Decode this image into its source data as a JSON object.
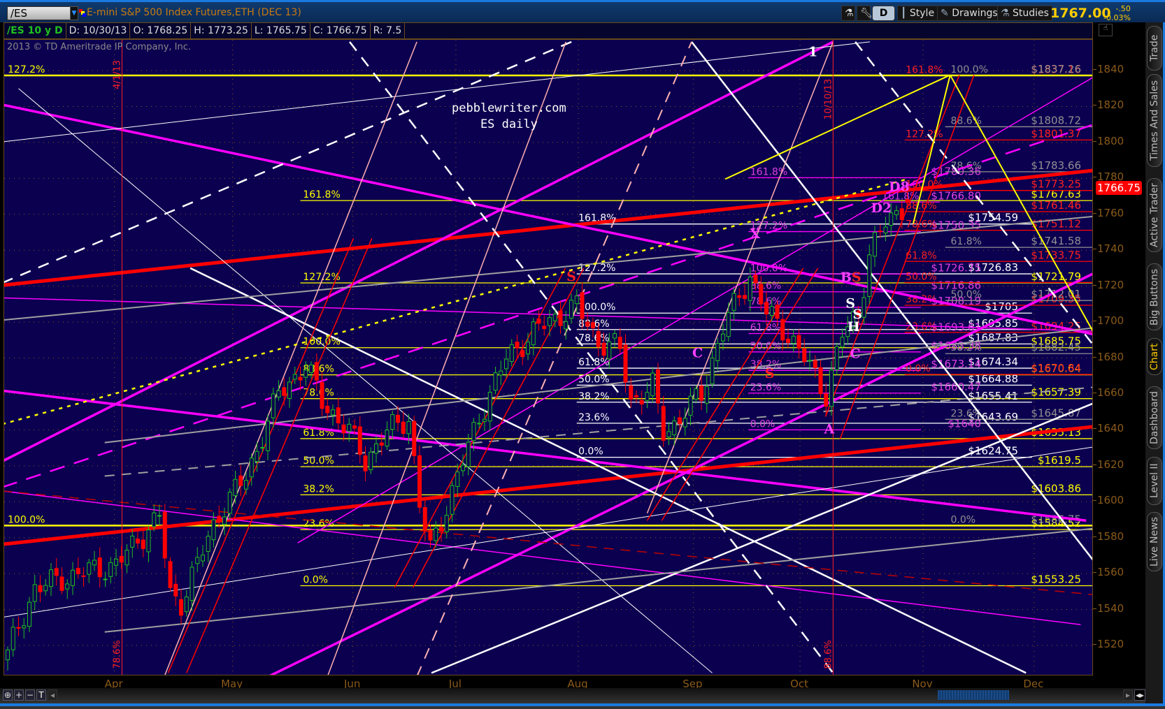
{
  "header": {
    "symbol": "/ES",
    "description": "E-mini S&P 500 Index Futures,ETH (DEC 13)",
    "buttons": {
      "d": "D",
      "style": "Style",
      "drawings": "Drawings",
      "studies": "Studies"
    },
    "last_price": "1767.00",
    "change": "-.50",
    "change_pct": "-0.03%"
  },
  "infobar": {
    "symbol_period": "/ES 10 y D",
    "date": "D: 10/30/13",
    "open": "O: 1768.25",
    "high": "H: 1773.25",
    "low": "L: 1765.75",
    "close": "C: 1766.75",
    "range": "R: 7.5"
  },
  "copyright": "2013 © TD Ameritrade IP Company, Inc.",
  "current_price_badge": "1766.75",
  "side_tabs": [
    "Trade",
    "Times And Sales",
    "Active Trader",
    "Big Buttons",
    "Chart",
    "Dashboard",
    "Level II",
    "Live News"
  ],
  "active_tab": "Chart",
  "colors": {
    "plot_bg": "#0b0050",
    "up": "#1fc01f",
    "down": "#ff0000",
    "axis": "#8a5a1a",
    "accent": "#ffcc00"
  },
  "chart_data": {
    "type": "candlestick",
    "title": "pebblewriter.com",
    "subtitle": "ES daily",
    "bars": 167,
    "last_bar": {
      "date": "10/30/13",
      "open": 1768.25,
      "high": 1773.25,
      "low": 1765.75,
      "close": 1766.75
    },
    "close_waypoints": [
      [
        0,
        1515
      ],
      [
        5,
        1552
      ],
      [
        13,
        1560
      ],
      [
        20,
        1565
      ],
      [
        28,
        1592
      ],
      [
        30,
        1548
      ],
      [
        32,
        1544
      ],
      [
        39,
        1594
      ],
      [
        44,
        1614
      ],
      [
        50,
        1660
      ],
      [
        55,
        1676
      ],
      [
        58,
        1656
      ],
      [
        63,
        1639
      ],
      [
        66,
        1623
      ],
      [
        70,
        1639
      ],
      [
        74,
        1647
      ],
      [
        76,
        1598
      ],
      [
        78,
        1573
      ],
      [
        81,
        1598
      ],
      [
        87,
        1647
      ],
      [
        92,
        1680
      ],
      [
        98,
        1697
      ],
      [
        105,
        1709
      ],
      [
        109,
        1689
      ],
      [
        113,
        1685
      ],
      [
        115,
        1656
      ],
      [
        119,
        1664
      ],
      [
        121,
        1639
      ],
      [
        123,
        1643
      ],
      [
        128,
        1660
      ],
      [
        132,
        1697
      ],
      [
        137,
        1726
      ],
      [
        140,
        1705
      ],
      [
        143,
        1697
      ],
      [
        147,
        1680
      ],
      [
        151,
        1660
      ],
      [
        154,
        1693
      ],
      [
        157,
        1705
      ],
      [
        159,
        1738
      ],
      [
        162,
        1755
      ],
      [
        166,
        1766.75
      ]
    ],
    "ylim": [
      1505,
      1855
    ],
    "y_ticks": [
      1520,
      1540,
      1560,
      1580,
      1600,
      1620,
      1640,
      1660,
      1680,
      1700,
      1720,
      1740,
      1760,
      1780,
      1800,
      1820,
      1840
    ],
    "x_ticks": [
      {
        "label": "Apr",
        "bar": 19.7
      },
      {
        "label": "May",
        "bar": 41.5
      },
      {
        "label": "Jun",
        "bar": 63.7
      },
      {
        "label": "Jul",
        "bar": 82.7
      },
      {
        "label": "Aug",
        "bar": 105.3
      },
      {
        "label": "Sep",
        "bar": 126.5
      },
      {
        "label": "Oct",
        "bar": 146.2
      },
      {
        "label": "Nov",
        "bar": 168.9
      },
      {
        "label": "Dec",
        "bar": 189.4
      }
    ],
    "fibs": {
      "yellow": [
        {
          "label": "0.0%",
          "price": 1553.25,
          "price_label": "$1553.25"
        },
        {
          "label": "23.6%",
          "price": 1584.52,
          "price_label": "$1584.52"
        },
        {
          "label": "38.2%",
          "price": 1603.86,
          "price_label": "$1603.86"
        },
        {
          "label": "50.0%",
          "price": 1619.5,
          "price_label": "$1619.5"
        },
        {
          "label": "61.8%",
          "price": 1635.13,
          "price_label": "$1635.13"
        },
        {
          "label": "78.6%",
          "price": 1657.39,
          "price_label": "$1657.39"
        },
        {
          "label": "88.6%",
          "price": 1670.64,
          "price_label": "$1670.64"
        },
        {
          "label": "100.0%",
          "price": 1685.75,
          "price_label": "$1685.75"
        },
        {
          "label": "127.2%",
          "price": 1721.79,
          "price_label": "$1721.79"
        },
        {
          "label": "161.8%",
          "price": 1767.63,
          "price_label": "$1767.63"
        }
      ],
      "white": [
        {
          "label": "0.0%",
          "price": 1624.75,
          "price_label": "$1624.75"
        },
        {
          "label": "23.6%",
          "price": 1643.69,
          "price_label": "$1643.69"
        },
        {
          "label": "38.2%",
          "price": 1655.41,
          "price_label": "$1655.41"
        },
        {
          "label": "50.0%",
          "price": 1664.88,
          "price_label": "$1664.88"
        },
        {
          "label": "61.8%",
          "price": 1674.34,
          "price_label": "$1674.34"
        },
        {
          "label": "78.6%",
          "price": 1687.83,
          "price_label": "$1687.83"
        },
        {
          "label": "88.6%",
          "price": 1695.85,
          "price_label": "$1695.85"
        },
        {
          "label": "100.0%",
          "price": 1705,
          "price_label": "$1705"
        },
        {
          "label": "127.2%",
          "price": 1726.83,
          "price_label": "$1726.83"
        },
        {
          "label": "161.8%",
          "price": 1754.59,
          "price_label": "$1754.59"
        }
      ],
      "magenta": [
        {
          "label": "0.0%",
          "price": 1640,
          "price_label": "$1640"
        },
        {
          "label": "23.6%",
          "price": 1660.47,
          "price_label": "$1660.47"
        },
        {
          "label": "38.2%",
          "price": 1673.14,
          "price_label": "$1673.14"
        },
        {
          "label": "50.0%",
          "price": 1683.38,
          "price_label": "$1683.38"
        },
        {
          "label": "61.8%",
          "price": 1693.61,
          "price_label": "$1693.61"
        },
        {
          "label": "78.6%",
          "price": 1708.19,
          "price_label": "$1708.19"
        },
        {
          "label": "88.6%",
          "price": 1716.86,
          "price_label": "$1716.86"
        },
        {
          "label": "100.0%",
          "price": 1726.75,
          "price_label": "$1726.75"
        },
        {
          "label": "127.2%",
          "price": 1750.35,
          "price_label": "$1750.35"
        },
        {
          "label": "161.8%",
          "price": 1780.36,
          "price_label": "$1780.36"
        }
      ],
      "magenta2": [
        {
          "label": "161.8%",
          "price": 1766.8,
          "price_label": "$1766.80"
        }
      ],
      "red": [
        {
          "label": "0.0%",
          "price": 1670.84,
          "price_label": "$1670.84"
        },
        {
          "label": "23.6%",
          "price": 1694.25,
          "price_label": "$1694.25"
        },
        {
          "label": "38.2%",
          "price": 1709.35,
          "price_label": "$1709.35"
        },
        {
          "label": "50.0%",
          "price": 1722.05,
          "price_label": null
        },
        {
          "label": "61.8%",
          "price": 1733.75,
          "price_label": "$1733.75"
        },
        {
          "label": "78.6%",
          "price": 1751.12,
          "price_label": "$1751.12"
        },
        {
          "label": "88.6%",
          "price": 1761.46,
          "price_label": "$1761.46"
        },
        {
          "label": "100.0%",
          "price": 1773.25,
          "price_label": "$1773.25"
        },
        {
          "label": "127.2%",
          "price": 1801.37,
          "price_label": "$1801.37"
        },
        {
          "label": "161.8%",
          "price": 1837.16,
          "price_label": "$1837.16"
        }
      ],
      "gray": [
        {
          "label": "0.0%",
          "price": 1586.75,
          "price_label": "$1586.75"
        },
        {
          "label": "23.6%",
          "price": 1645.87,
          "price_label": "$1645.87"
        },
        {
          "label": "38.2%",
          "price": 1682.45,
          "price_label": "$1682.45"
        },
        {
          "label": "50.0%",
          "price": 1712.01,
          "price_label": "$1712.01"
        },
        {
          "label": "61.8%",
          "price": 1741.58,
          "price_label": "$1741.58"
        },
        {
          "label": "78.6%",
          "price": 1783.66,
          "price_label": "$1783.66"
        },
        {
          "label": "88.6%",
          "price": 1808.72,
          "price_label": "$1808.72"
        },
        {
          "label": "100.0%",
          "price": 1837.26,
          "price_label": "$1837.26"
        }
      ],
      "yellow_left": [
        {
          "label": "100.0%",
          "price": 1586.75,
          "price_label": null
        },
        {
          "label": "127.2%",
          "price": 1837.26,
          "price_label": null
        }
      ]
    },
    "vertical_lines": [
      {
        "bar": 21.1,
        "top_label": "4/1/13",
        "bottom_label": "78.6%"
      },
      {
        "bar": 152.3,
        "top_label": "10/10/13",
        "bottom_label": "88.6%"
      }
    ],
    "trendlines": [
      {
        "from": [
          -1,
          1720.5
        ],
        "to": [
          201,
          1784.6
        ],
        "style": "red-thick"
      },
      {
        "from": [
          -1,
          1576.3
        ],
        "to": [
          201,
          1642.0
        ],
        "style": "red-thick"
      },
      {
        "from": [
          -1,
          1622.5
        ],
        "to": [
          152.3,
          1856
        ],
        "style": "magenta-thick"
      },
      {
        "from": [
          48.1,
          1502.7
        ],
        "to": [
          201,
          1728
        ],
        "style": "magenta-thick"
      },
      {
        "from": [
          -1,
          1821
        ],
        "to": [
          201,
          1692.8
        ],
        "style": "magenta-thick"
      },
      {
        "from": [
          -1,
          1661.8
        ],
        "to": [
          199,
          1589.5
        ],
        "style": "magenta-thick"
      },
      {
        "from": [
          -1,
          1713.5
        ],
        "to": [
          201,
          1694.9
        ],
        "style": "magenta"
      },
      {
        "from": [
          -1,
          1608.1
        ],
        "to": [
          201,
          1810.6
        ],
        "style": "magenta-dash"
      },
      {
        "from": [
          -1,
          1606
        ],
        "to": [
          198,
          1531.6
        ],
        "style": "magenta"
      },
      {
        "from": [
          53.5,
          1577.1
        ],
        "to": [
          201,
          1837.5
        ],
        "style": "magenta"
      },
      {
        "from": [
          -1,
          1721.8
        ],
        "to": [
          105.6,
          1858
        ],
        "style": "white-dash"
      },
      {
        "from": [
          63.1,
          1856
        ],
        "to": [
          152.3,
          1504.7
        ],
        "style": "white-dash"
      },
      {
        "from": [
          156.4,
          1856
        ],
        "to": [
          201,
          1684.6
        ],
        "style": "white-dash"
      },
      {
        "from": [
          33.7,
          1730
        ],
        "to": [
          187.9,
          1504.7
        ],
        "style": "white-thick"
      },
      {
        "from": [
          126.2,
          1856
        ],
        "to": [
          201,
          1564.7
        ],
        "style": "white-thick"
      },
      {
        "from": [
          78.2,
          1504.7
        ],
        "to": [
          201,
          1655.6
        ],
        "style": "white-thick"
      },
      {
        "from": [
          -1,
          1800.3
        ],
        "to": [
          159.1,
          1856
        ],
        "style": "white"
      },
      {
        "from": [
          -1,
          1535.7
        ],
        "to": [
          201,
          1630.8
        ],
        "style": "white"
      },
      {
        "from": [
          2,
          1830
        ],
        "to": [
          130,
          1504.7
        ],
        "style": "white"
      },
      {
        "from": [
          -1,
          1701.1
        ],
        "to": [
          201,
          1759
        ],
        "style": "gray"
      },
      {
        "from": [
          17.9,
          1632.9
        ],
        "to": [
          201,
          1697
        ],
        "style": "gray"
      },
      {
        "from": [
          17.9,
          1614.3
        ],
        "to": [
          201,
          1663.9
        ],
        "style": "gray-dash"
      },
      {
        "from": [
          17.9,
          1527.5
        ],
        "to": [
          201,
          1585.3
        ],
        "style": "gray"
      },
      {
        "from": [
          28.9,
          1502.7
        ],
        "to": [
          75.5,
          1856
        ],
        "style": "pink"
      },
      {
        "from": [
          118,
          1593.6
        ],
        "to": [
          152.3,
          1856
        ],
        "style": "pink"
      },
      {
        "from": [
          59,
          1502.7
        ],
        "to": [
          103,
          1856
        ],
        "style": "pink"
      },
      {
        "from": [
          75.5,
          1502.7
        ],
        "to": [
          126.2,
          1856
        ],
        "style": "pink-dash"
      },
      {
        "from": [
          29.6,
          1504.7
        ],
        "to": [
          63.8,
          1746.6
        ],
        "style": "red"
      },
      {
        "from": [
          33,
          1504.7
        ],
        "to": [
          67.2,
          1746.6
        ],
        "style": "red"
      },
      {
        "from": [
          71.4,
          1552.3
        ],
        "to": [
          102.9,
          1730
        ],
        "style": "red"
      },
      {
        "from": [
          74.8,
          1552.3
        ],
        "to": [
          106.3,
          1730
        ],
        "style": "red"
      },
      {
        "from": [
          118,
          1589.5
        ],
        "to": [
          146.8,
          1730
        ],
        "style": "red"
      },
      {
        "from": [
          120.7,
          1589.5
        ],
        "to": [
          149.5,
          1730
        ],
        "style": "red"
      },
      {
        "from": [
          150.9,
          1647.4
        ],
        "to": [
          175.6,
          1837.5
        ],
        "style": "red"
      },
      {
        "from": [
          153.6,
          1635
        ],
        "to": [
          178.3,
          1837.5
        ],
        "style": "red"
      },
      {
        "from": [
          -1,
          1606
        ],
        "to": [
          201,
          1548.1
        ],
        "style": "darkred-dash"
      },
      {
        "from": [
          -1,
          1643.2
        ],
        "to": [
          166,
          1779.6
        ],
        "style": "yellow-dot"
      },
      {
        "from": [
          132.4,
          1779.6
        ],
        "to": [
          173.9,
          1837.5
        ],
        "style": "yellow"
      },
      {
        "from": [
          167.1,
          1754.8
        ],
        "to": [
          173.9,
          1837.5
        ],
        "style": "yellow"
      },
      {
        "from": [
          173.9,
          1837.5
        ],
        "to": [
          201,
          1690.8
        ],
        "style": "yellow"
      }
    ],
    "annotations": [
      {
        "text": "1",
        "bar": 148.6,
        "price": 1848,
        "color": "#ffffff"
      },
      {
        "text": "S",
        "bar": 104,
        "price": 1723,
        "color": "#ff2020"
      },
      {
        "text": "X",
        "bar": 137.9,
        "price": 1746.6,
        "color": "#ff40ff"
      },
      {
        "text": "C",
        "bar": 127.3,
        "price": 1680.4,
        "color": "#ff40ff"
      },
      {
        "text": "S",
        "bar": 140.6,
        "price": 1668.9,
        "color": "#ff2020"
      },
      {
        "text": "B",
        "bar": 154.7,
        "price": 1722.6,
        "color": "#ff40ff"
      },
      {
        "text": "S",
        "bar": 156.6,
        "price": 1722.6,
        "color": "#ff2020"
      },
      {
        "text": "S",
        "bar": 155.5,
        "price": 1708,
        "color": "#ffffff"
      },
      {
        "text": "S",
        "bar": 156.8,
        "price": 1702,
        "color": "#ffffff"
      },
      {
        "text": "H",
        "bar": 156.1,
        "price": 1695,
        "color": "#ffffff"
      },
      {
        "text": "C",
        "bar": 156.4,
        "price": 1680,
        "color": "#ff40ff"
      },
      {
        "text": "A",
        "bar": 151.6,
        "price": 1638,
        "color": "#ff40ff"
      },
      {
        "text": "D2",
        "bar": 161.2,
        "price": 1761,
        "color": "#ff40ff"
      },
      {
        "text": "D8",
        "bar": 164.5,
        "price": 1773,
        "color": "#ff40ff"
      }
    ]
  }
}
